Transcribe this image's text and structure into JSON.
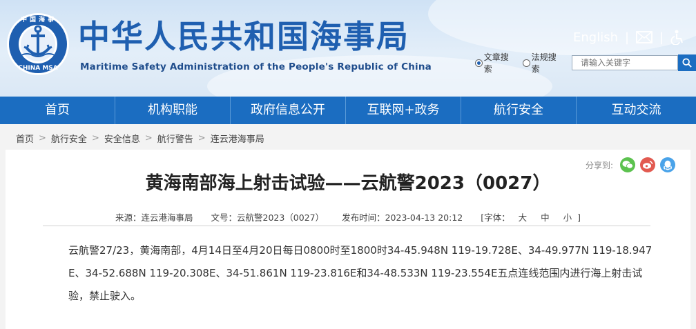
{
  "header": {
    "logo_top_text": "中国海事",
    "logo_bottom_text": "CHINA MSA",
    "site_title": "中华人民共和国海事局",
    "site_subtitle": "Maritime Safety Administration of the People's Republic of China",
    "english_label": "English",
    "search": {
      "option_article": "文章搜索",
      "option_law": "法规搜索",
      "placeholder": "请输入关键字"
    },
    "icons": {
      "mail": "mail-icon",
      "accessibility": "accessibility-icon",
      "search": "search-icon"
    }
  },
  "nav": {
    "items": [
      {
        "label": "首页"
      },
      {
        "label": "机构职能"
      },
      {
        "label": "政府信息公开"
      },
      {
        "label": "互联网+政务"
      },
      {
        "label": "航行安全"
      },
      {
        "label": "互动交流"
      }
    ]
  },
  "breadcrumb": {
    "items": [
      "首页",
      "航行安全",
      "安全信息",
      "航行警告",
      "连云港海事局"
    ]
  },
  "share": {
    "label": "分享到:",
    "buttons": [
      {
        "name": "wechat",
        "color": "#5cc24f"
      },
      {
        "name": "weibo",
        "color": "#e25a50"
      },
      {
        "name": "qq",
        "color": "#4aa3e9"
      }
    ]
  },
  "article": {
    "title": "黄海南部海上射击试验——云航警2023（0027）",
    "source": "来源：连云港海事局",
    "doc_no": "文号：云航警2023（0027）",
    "publish_time": "发布时间：2023-04-13 20:12",
    "font_label": "[字体：",
    "font_large": "大",
    "font_medium": "中",
    "font_small": "小",
    "font_end": "]",
    "body": "云航警27/23，黄海南部，4月14日至4月20日每日0800时至1800时34-45.948N 119-19.728E、34-49.977N 119-18.947E、34-52.688N 119-20.308E、34-51.861N 119-23.816E和34-48.533N 119-23.554E五点连线范围内进行海上射击试验，禁止驶入。"
  },
  "colors": {
    "brand_blue": "#1f5fb0",
    "nav_blue": "#1b6dc1"
  }
}
